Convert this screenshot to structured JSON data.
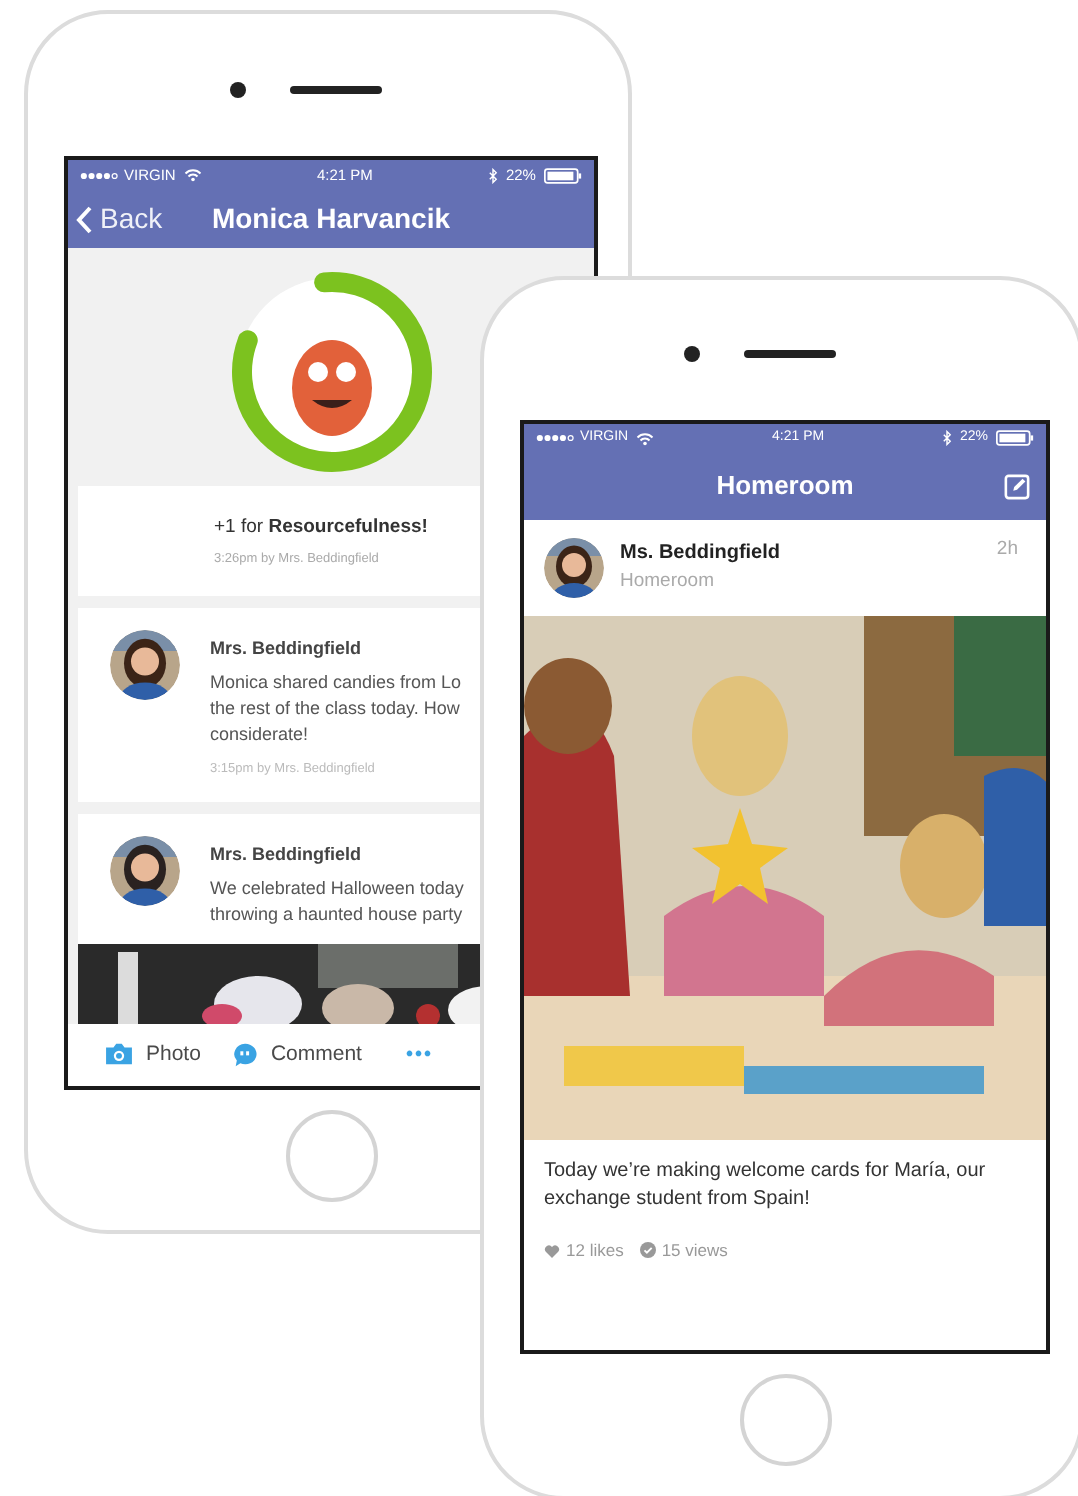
{
  "back_phone": {
    "status_bar": {
      "carrier": "VIRGIN",
      "time": "4:21 PM",
      "battery": "22%"
    },
    "nav": {
      "back": "Back",
      "title": "Monica Harvancik"
    },
    "award": {
      "level": 0.82,
      "text": "+1 for **Resourcefulness!**",
      "meta": "3:26pm by Mrs. Beddingfield"
    },
    "posts": [
      {
        "author": "Mrs. Beddingfield",
        "lines": [
          "Monica shared candies from Lo",
          "the rest of the class today. How",
          "considerate!"
        ],
        "meta": "3:15pm by Mrs. Beddingfield",
        "photo": false
      },
      {
        "author": "Mrs. Beddingfield",
        "lines": [
          "We celebrated Halloween today",
          "throwing a haunted house party"
        ],
        "photo": true
      }
    ],
    "actions": [
      {
        "label": "Photo"
      },
      {
        "kind": "comment",
        "label": "Comment"
      },
      {
        "kind": "more",
        "label": "•••"
      }
    ]
  },
  "front_phone": {
    "status_bar": {
      "carrier": "VIRGIN",
      "time": "4:21 PM",
      "battery": "22%"
    },
    "nav": {
      "title": "Homeroom"
    },
    "post": {
      "author": "Ms. Beddingfield",
      "group": "Homeroom",
      "age": "2h",
      "caption": "Today we’re making welcome cards for María, our exchange student from Spain!",
      "likes": "12 likes",
      "views": "15 views"
    }
  }
}
